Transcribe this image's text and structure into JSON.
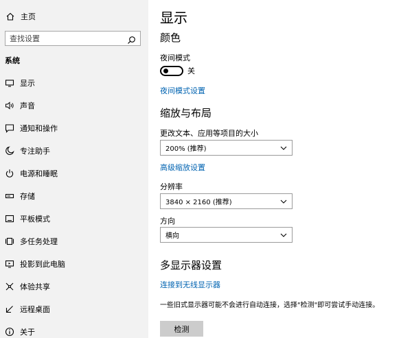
{
  "sidebar": {
    "home_label": "主页",
    "search_placeholder": "查找设置",
    "section_label": "系统",
    "items": [
      {
        "label": "显示",
        "icon": "monitor-icon"
      },
      {
        "label": "声音",
        "icon": "speaker-icon"
      },
      {
        "label": "通知和操作",
        "icon": "notification-icon"
      },
      {
        "label": "专注助手",
        "icon": "moon-icon"
      },
      {
        "label": "电源和睡眠",
        "icon": "power-icon"
      },
      {
        "label": "存储",
        "icon": "storage-icon"
      },
      {
        "label": "平板模式",
        "icon": "tablet-icon"
      },
      {
        "label": "多任务处理",
        "icon": "multitask-icon"
      },
      {
        "label": "投影到此电脑",
        "icon": "projection-icon"
      },
      {
        "label": "体验共享",
        "icon": "share-icon"
      },
      {
        "label": "远程桌面",
        "icon": "remote-desktop-icon"
      },
      {
        "label": "关于",
        "icon": "info-icon"
      }
    ]
  },
  "main": {
    "title": "显示",
    "color_heading": "颜色",
    "night_mode_label": "夜间模式",
    "night_mode_state": "关",
    "night_mode_settings_link": "夜间模式设置",
    "scale_heading": "缩放与布局",
    "scale_label": "更改文本、应用等项目的大小",
    "scale_value": "200% (推荐)",
    "advanced_scale_link": "高级缩放设置",
    "resolution_label": "分辨率",
    "resolution_value": "3840 × 2160 (推荐)",
    "orientation_label": "方向",
    "orientation_value": "横向",
    "multi_display_heading": "多显示器设置",
    "wireless_link": "连接到无线显示器",
    "detect_description": "一些旧式显示器可能不会进行自动连接，选择\"检测\"即可尝试手动连接。",
    "detect_button": "检测"
  }
}
